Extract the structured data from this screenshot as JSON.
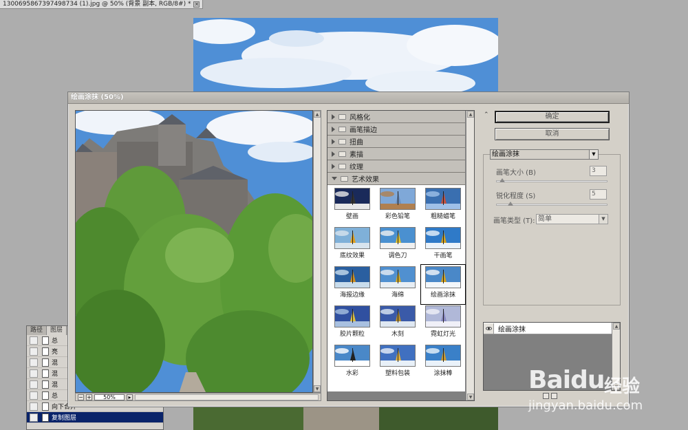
{
  "document": {
    "tab_title": "1300695867397498734 (1).jpg @ 50% (背景 副本, RGB/8#) *",
    "close_glyph": "×"
  },
  "layers_panel": {
    "tabs": [
      "路径",
      "图层"
    ],
    "rows": [
      "总",
      "亮",
      "混",
      "混",
      "混",
      "总",
      "向下合并",
      "复制图层"
    ]
  },
  "dialog": {
    "title": "绘画涂抹 (50%)",
    "zoom_value": "50%",
    "ok_label": "确定",
    "cancel_label": "取消",
    "collapse_glyph": "⌃",
    "categories": [
      "风格化",
      "画笔描边",
      "扭曲",
      "素描",
      "纹理",
      "艺术效果"
    ],
    "filters": [
      "壁画",
      "彩色铅笔",
      "粗糙蜡笔",
      "底纹效果",
      "调色刀",
      "干画笔",
      "海报边缘",
      "海绵",
      "绘画涂抹",
      "胶片颗粒",
      "木刻",
      "霓虹灯光",
      "水彩",
      "塑料包装",
      "涂抹棒"
    ],
    "selected_filter_index": 8,
    "filter_select_value": "绘画涂抹",
    "params": {
      "brush_size_label": "画笔大小 (B)",
      "brush_size_value": "3",
      "brush_size_fraction": 0.05,
      "sharpness_label": "锐化程度 (S)",
      "sharpness_value": "5",
      "sharpness_fraction": 0.125,
      "brush_type_label": "画笔类型 (T):",
      "brush_type_value": "简单"
    },
    "effect_layers": [
      "绘画涂抹"
    ]
  },
  "watermark": {
    "main": "Baidu",
    "sub": "经验",
    "url": "jingyan.baidu.com"
  }
}
